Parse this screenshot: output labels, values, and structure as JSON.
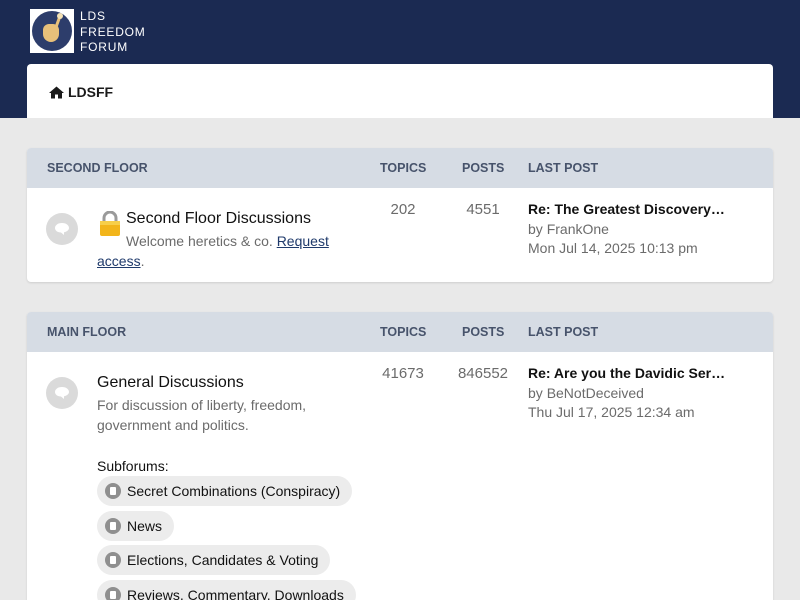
{
  "site": {
    "name_lines": [
      "LDS",
      "FREEDOM",
      "FORUM"
    ],
    "logo_icon": "torch-hand-icon"
  },
  "nav": {
    "home_icon": "home-icon",
    "home_label": "LDSFF"
  },
  "columns": {
    "topics": "TOPICS",
    "posts": "POSTS",
    "last_post": "LAST POST"
  },
  "categories": [
    {
      "name": "SECOND FLOOR",
      "forums": [
        {
          "title": "Second Floor Discussions",
          "locked": true,
          "description": "Welcome heretics & co.",
          "link_text": "Request access",
          "link_text_part1": "Request",
          "link_text_part2": "access",
          "trailing": ".",
          "topics": "202",
          "posts": "4551",
          "last_post_title": "Re: The Greatest Discovery in…",
          "last_post_by_prefix": "by",
          "last_post_author": "FrankOne",
          "last_post_date": "Mon Jul 14, 2025 10:13 pm"
        }
      ]
    },
    {
      "name": "MAIN FLOOR",
      "forums": [
        {
          "title": "General Discussions",
          "description_lines": [
            "For discussion of liberty, freedom,",
            "government and politics."
          ],
          "topics": "41673",
          "posts": "846552",
          "last_post_title": "Re: Are you the Davidic Serva…",
          "last_post_by_prefix": "by",
          "last_post_author": "BeNotDeceived",
          "last_post_date": "Thu Jul 17, 2025 12:34 am",
          "subforums_label": "Subforums:",
          "subforums": [
            "Secret Combinations (Conspiracy)",
            "News",
            "Elections, Candidates & Voting",
            "Reviews, Commentary, Downloads"
          ]
        }
      ]
    }
  ],
  "colors": {
    "header_bg": "#1b2a52",
    "page_bg": "#e9e9e9",
    "category_header_bg": "#d6dce4",
    "category_header_text": "#47536b",
    "link": "#1f3a6b"
  }
}
